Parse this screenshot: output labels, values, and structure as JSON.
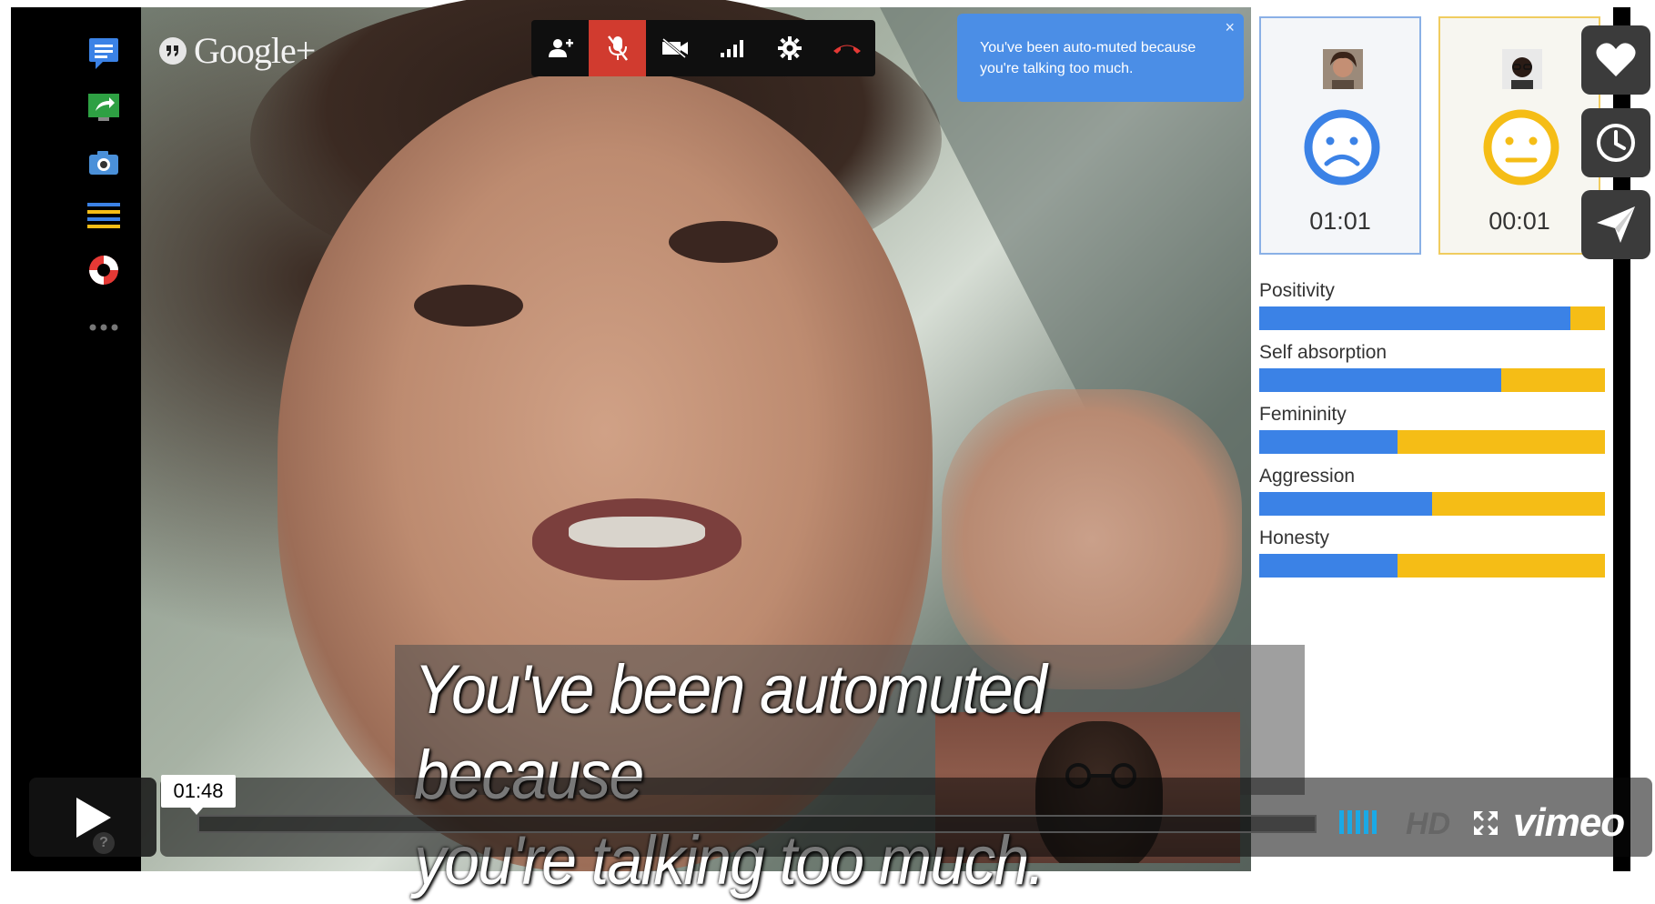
{
  "app": {
    "logo_text": "Google+",
    "logo_badge": "g"
  },
  "notification": {
    "line1": "You've been auto-muted because",
    "line2": "you're talking too much.",
    "close": "×"
  },
  "participants": [
    {
      "timer": "01:01",
      "mood": "sad",
      "accent": "#3b82e6"
    },
    {
      "timer": "00:01",
      "mood": "neutral",
      "accent": "#f5bd16"
    }
  ],
  "metrics": [
    {
      "label": "Positivity",
      "value": 0.9
    },
    {
      "label": "Self absorption",
      "value": 0.7
    },
    {
      "label": "Femininity",
      "value": 0.4
    },
    {
      "label": "Aggression",
      "value": 0.5
    },
    {
      "label": "Honesty",
      "value": 0.4
    }
  ],
  "subtitle": {
    "line1": "You've been automuted because",
    "line2": "you're talking too much."
  },
  "player": {
    "time": "01:48",
    "help": "?",
    "hd": "HD",
    "brand": "vimeo",
    "progress": 0.0
  },
  "toolbar_icons": [
    "add-person-icon",
    "mic-muted-icon",
    "camera-off-icon",
    "signal-icon",
    "settings-icon",
    "hang-up-icon"
  ],
  "sidebar_icons": [
    "chat-icon",
    "screenshare-icon",
    "camera-icon",
    "document-icon",
    "help-lifesaver-icon",
    "more-icon"
  ],
  "action_icons": [
    "heart-icon",
    "clock-icon",
    "send-icon"
  ],
  "colors": {
    "blue": "#3b82e6",
    "yellow": "#f5bd16",
    "mute_red": "#d13b2f",
    "notif_blue": "#4b8ee6"
  }
}
